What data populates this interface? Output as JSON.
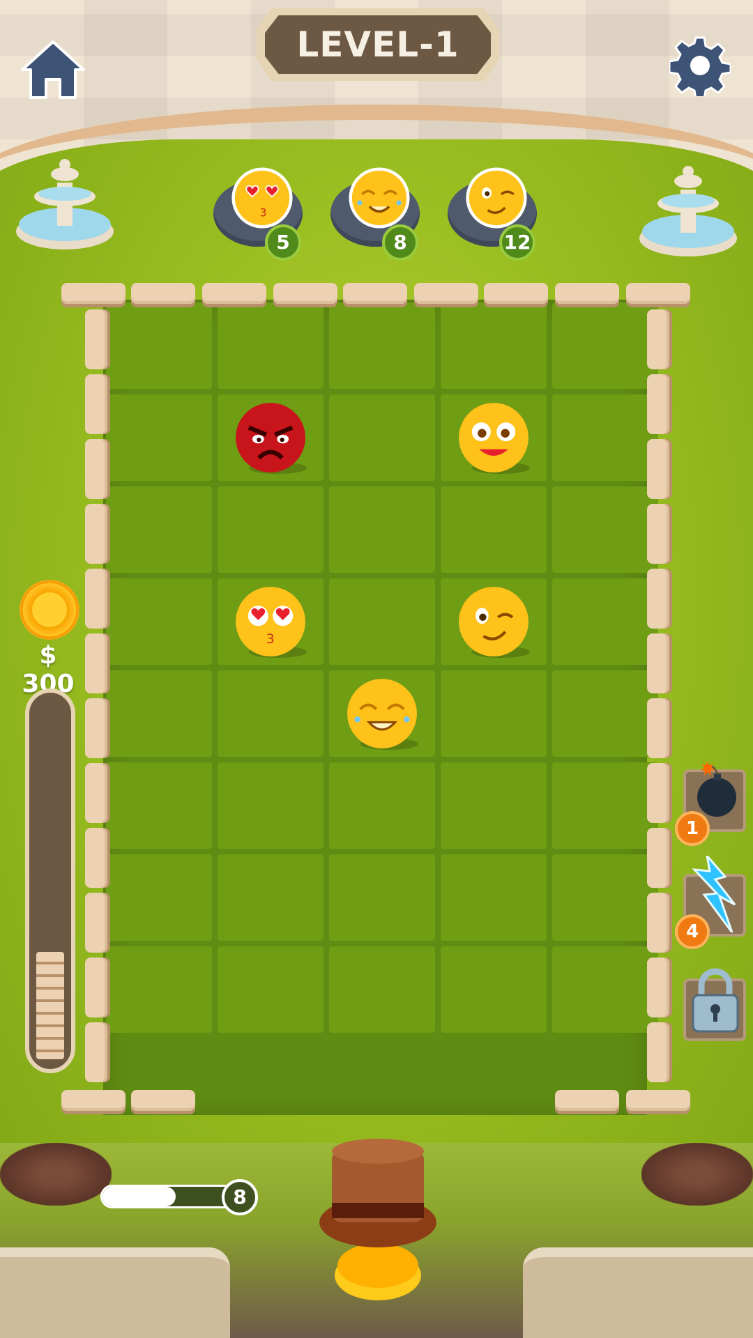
{
  "header": {
    "level_title": "LEVEL-1",
    "home_icon": "home-icon",
    "settings_icon": "gear-icon"
  },
  "targets": [
    {
      "emoji": "heart-eyes-kiss-emoji",
      "count": "5"
    },
    {
      "emoji": "laughing-tears-emoji",
      "count": "8"
    },
    {
      "emoji": "wink-emoji",
      "count": "12"
    }
  ],
  "board": {
    "columns": 5,
    "rows": 8,
    "pieces": [
      {
        "emoji": "angry-red-emoji",
        "col": 1,
        "row": 1
      },
      {
        "emoji": "smiling-googly-eyes-emoji",
        "col": 3,
        "row": 1
      },
      {
        "emoji": "heart-eyes-kiss-emoji",
        "col": 1,
        "row": 3
      },
      {
        "emoji": "wink-emoji",
        "col": 3,
        "row": 3
      },
      {
        "emoji": "laughing-tears-emoji",
        "col": 2,
        "row": 4
      }
    ]
  },
  "coins": {
    "label": "$ 300",
    "icon": "coin-icon"
  },
  "power_meter": {
    "level": 0.3
  },
  "powerups": [
    {
      "name": "bomb",
      "icon": "bomb-icon",
      "count": "1"
    },
    {
      "name": "lightning",
      "icon": "lightning-icon",
      "count": "4"
    },
    {
      "name": "locked",
      "icon": "padlock-icon",
      "count": null
    }
  ],
  "shots": {
    "remaining": "8",
    "progress": 0.55
  },
  "colors": {
    "grass": "#6f9d14",
    "wood": "#6d5843",
    "stone": "#ecd2b2",
    "badge_green": "#4f8a1a",
    "badge_orange": "#f07a12",
    "icon_blue": "#3d5477"
  }
}
